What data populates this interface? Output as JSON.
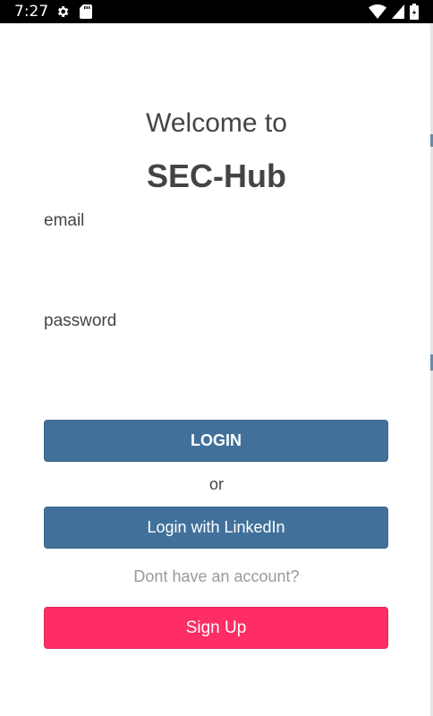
{
  "status_bar": {
    "time": "7:27",
    "icons": [
      "gear-icon",
      "sd-card-icon",
      "wifi-icon",
      "cell-signal-icon",
      "battery-icon"
    ]
  },
  "header": {
    "welcome": "Welcome to",
    "app_name": "SEC-Hub"
  },
  "form": {
    "email_label": "email",
    "email_value": "",
    "password_label": "password",
    "password_value": ""
  },
  "actions": {
    "login_label": "LOGIN",
    "or_text": "or",
    "linkedin_label": "Login with LinkedIn",
    "no_account_text": "Dont have an account?",
    "signup_label": "Sign Up"
  },
  "colors": {
    "primary_button": "#41719b",
    "signup_button": "#fe2d65",
    "text": "#444444",
    "muted_text": "#9a9a9a"
  }
}
